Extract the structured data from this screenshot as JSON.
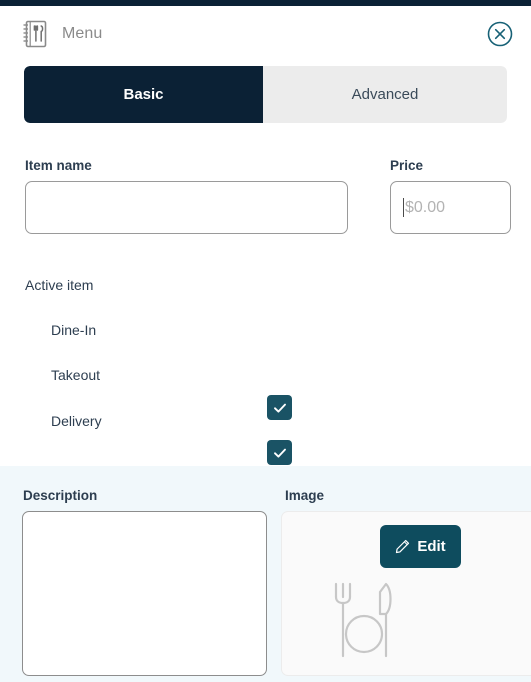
{
  "window": {
    "accent_dark": "#0b2135",
    "accent_teal": "#0e4c5e",
    "checkbox_teal": "#1a5365",
    "panel_tint": "#f1f8fb"
  },
  "header": {
    "icon": "menu-book-icon",
    "title": "Menu",
    "close_icon": "close-circle-icon"
  },
  "tabs": [
    {
      "label": "Basic",
      "active": true
    },
    {
      "label": "Advanced",
      "active": false
    }
  ],
  "form": {
    "item_name": {
      "label": "Item name",
      "value": "",
      "placeholder": ""
    },
    "price": {
      "label": "Price",
      "value": "",
      "placeholder": "$0.00"
    },
    "checkboxes": [
      {
        "label": "Active item",
        "checked": true
      },
      {
        "label": "Dine-In",
        "checked": true
      },
      {
        "label": "Takeout",
        "checked": true
      },
      {
        "label": "Delivery",
        "checked": true
      }
    ]
  },
  "bottom": {
    "description": {
      "label": "Description",
      "value": "",
      "placeholder": ""
    },
    "image": {
      "label": "Image",
      "edit_button_label": "Edit",
      "edit_icon": "pencil-icon",
      "placeholder_icon": "fork-plate-knife-icon"
    }
  }
}
